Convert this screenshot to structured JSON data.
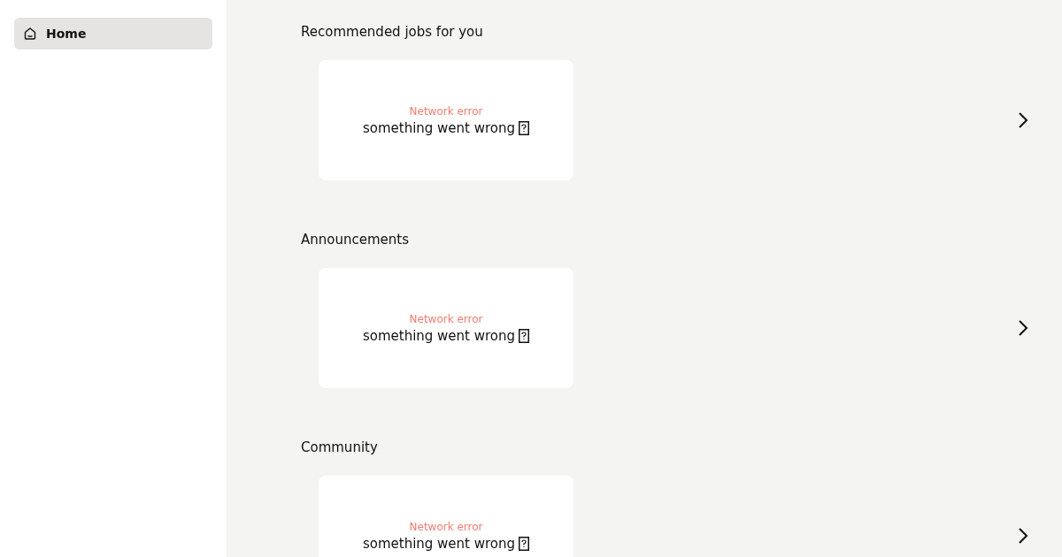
{
  "sidebar": {
    "items": [
      {
        "label": "Home",
        "selected": true
      }
    ]
  },
  "sections": [
    {
      "title": "Recommended jobs for you",
      "card": {
        "error": "Network error",
        "message": "something went wrong"
      }
    },
    {
      "title": "Announcements",
      "card": {
        "error": "Network error",
        "message": "something went wrong"
      }
    },
    {
      "title": "Community",
      "card": {
        "error": "Network error",
        "message": "something went wrong"
      }
    }
  ]
}
